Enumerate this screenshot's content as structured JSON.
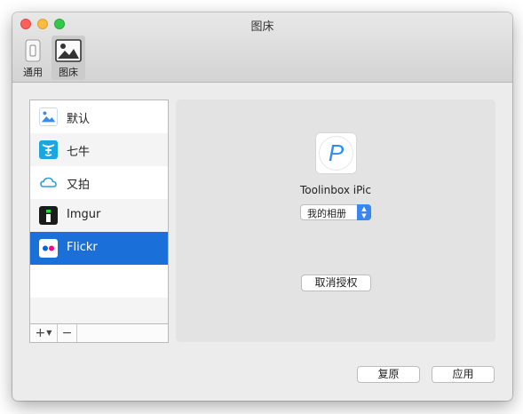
{
  "window": {
    "title": "图床"
  },
  "toolbar": {
    "items": [
      {
        "label": "通用"
      },
      {
        "label": "图床"
      }
    ]
  },
  "hosts": {
    "items": [
      {
        "label": "默认"
      },
      {
        "label": "七牛"
      },
      {
        "label": "又拍"
      },
      {
        "label": "Imgur"
      },
      {
        "label": "Flickr"
      }
    ],
    "selected": "Flickr",
    "add_label": "+",
    "remove_label": "−"
  },
  "detail": {
    "logo_letter": "P",
    "host_name": "Toolinbox iPic",
    "album_value": "我的相册",
    "revoke_label": "取消授权"
  },
  "footer": {
    "revert_label": "复原",
    "apply_label": "应用"
  },
  "colors": {
    "selection": "#1b6fd8",
    "accent": "#3a86f0",
    "flickr_pink": "#ff0084",
    "flickr_blue": "#0063dc"
  }
}
